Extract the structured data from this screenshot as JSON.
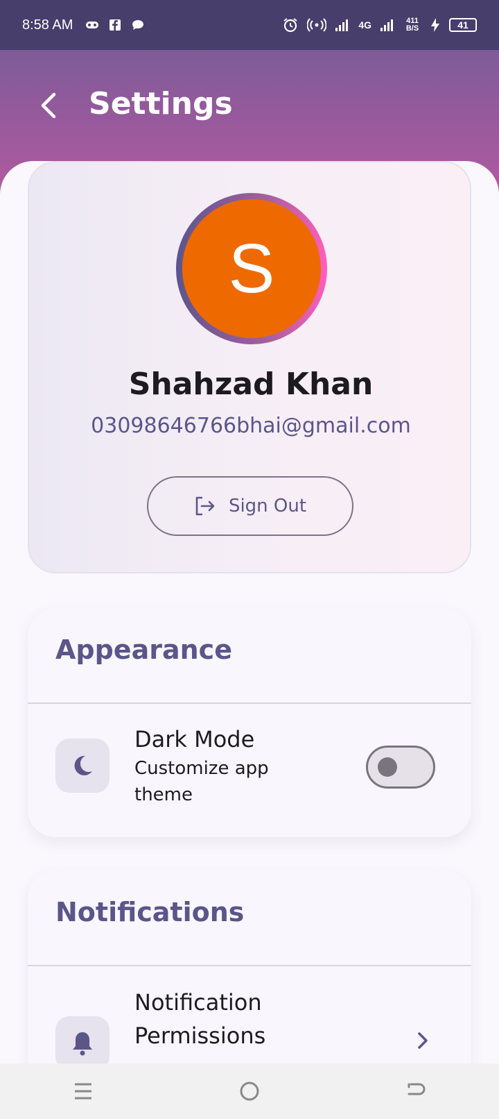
{
  "status_bar": {
    "time": "8:58 AM",
    "network_speed": "411 B/S",
    "network_type": "4G",
    "battery": "41",
    "icons_left": [
      "game-controller-icon",
      "facebook-icon",
      "chat-bubble-icon"
    ],
    "icons_right": [
      "alarm-icon",
      "hotspot-icon",
      "signal-icon",
      "signal-4g-icon",
      "charging-icon",
      "battery-icon"
    ]
  },
  "header": {
    "title": "Settings",
    "back_icon": "chevron-left-icon"
  },
  "profile": {
    "avatar_initial": "S",
    "name": "Shahzad Khan",
    "email": "03098646766bhai@gmail.com",
    "sign_out_label": "Sign Out"
  },
  "appearance": {
    "title": "Appearance",
    "dark_mode_title": "Dark Mode",
    "dark_mode_sub": "Customize app theme",
    "dark_mode_enabled": false
  },
  "notifications": {
    "title": "Notifications",
    "permissions_title": "Notification Permissions"
  },
  "nav_bar": {
    "items": [
      "menu-icon",
      "home-icon",
      "back-icon"
    ]
  },
  "colors": {
    "header_gradient_top": "#7e5b98",
    "header_gradient_bottom": "#b45c9d",
    "accent": "#5a568a",
    "avatar_bg": "#ee6a00"
  }
}
